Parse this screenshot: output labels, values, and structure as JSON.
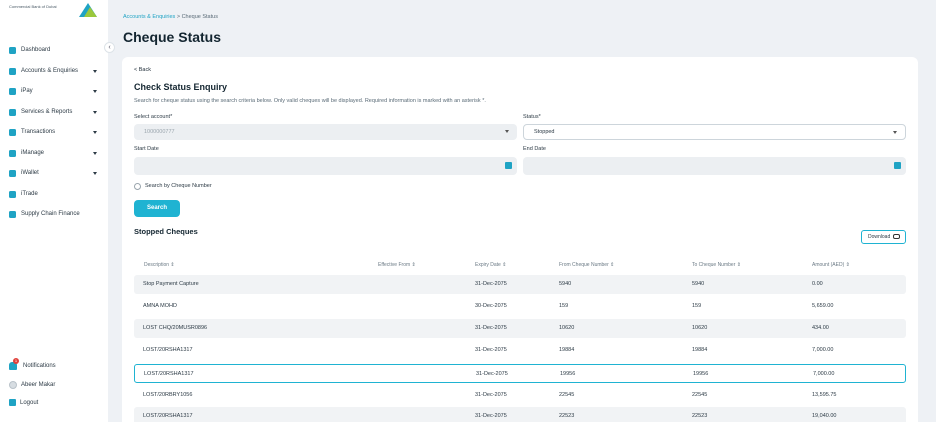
{
  "sidebar": {
    "logo_text": "Commercial Bank of Dubai",
    "items": [
      {
        "label": "Dashboard",
        "icon": "dashboard-icon",
        "caret": false
      },
      {
        "label": "Accounts & Enquiries",
        "icon": "accounts-icon",
        "caret": true
      },
      {
        "label": "iPay",
        "icon": "ipay-icon",
        "caret": true
      },
      {
        "label": "Services & Reports",
        "icon": "services-icon",
        "caret": true
      },
      {
        "label": "Transactions",
        "icon": "transactions-icon",
        "caret": true
      },
      {
        "label": "iManage",
        "icon": "imanage-icon",
        "caret": true
      },
      {
        "label": "iWallet",
        "icon": "iwallet-icon",
        "caret": true
      },
      {
        "label": "iTrade",
        "icon": "itrade-icon",
        "caret": false
      },
      {
        "label": "Supply Chain Finance",
        "icon": "supply-chain-icon",
        "caret": false
      }
    ],
    "notifications_label": "Notifications",
    "notifications_count": "1",
    "user_name": "Abeer Makar",
    "logout_label": "Logout"
  },
  "breadcrumb": {
    "parent": "Accounts & Enquiries",
    "separator": ">",
    "current": "Cheque Status"
  },
  "page_title": "Cheque Status",
  "form": {
    "back_label": "< Back",
    "title": "Check Status Enquiry",
    "description": "Search for cheque status using the search criteria below. Only valid cheques will be displayed. Required information is marked with an asterisk *.",
    "account_label": "Select account*",
    "account_value": "1000000777",
    "status_label": "Status*",
    "status_value": "Stopped",
    "start_date_label": "Start Date",
    "end_date_label": "End Date",
    "cheque_number_checkbox_label": "Search by Cheque Number",
    "search_button": "Search"
  },
  "results": {
    "title": "Stopped Cheques",
    "download_label": "Download",
    "columns": [
      "Description",
      "Effective From",
      "Expiry Date",
      "From Cheque Number",
      "To Cheque Number",
      "Amount (AED)"
    ],
    "rows": [
      {
        "description": "Stop Payment Capture",
        "effective_from": "",
        "expiry": "31-Dec-2075",
        "from": "5940",
        "to": "5940",
        "amount": "0.00"
      },
      {
        "description": "AMNA MOHD",
        "effective_from": "",
        "expiry": "30-Dec-2075",
        "from": "159",
        "to": "159",
        "amount": "5,659.00"
      },
      {
        "description": "LOST CHQ/20MUSR0896",
        "effective_from": "",
        "expiry": "31-Dec-2075",
        "from": "10620",
        "to": "10620",
        "amount": "434.00"
      },
      {
        "description": "LOST/20RSHA1317",
        "effective_from": "",
        "expiry": "31-Dec-2075",
        "from": "19884",
        "to": "19884",
        "amount": "7,000.00"
      },
      {
        "description": "LOST/20RSHA1317",
        "effective_from": "",
        "expiry": "31-Dec-2075",
        "from": "19956",
        "to": "19956",
        "amount": "7,000.00"
      },
      {
        "description": "LOST/20RBRY1056",
        "effective_from": "",
        "expiry": "31-Dec-2075",
        "from": "22545",
        "to": "22545",
        "amount": "13,595.75"
      },
      {
        "description": "LOST/20RSHA1317",
        "effective_from": "",
        "expiry": "31-Dec-2075",
        "from": "22523",
        "to": "22523",
        "amount": "19,040.00"
      }
    ]
  },
  "colors": {
    "accent": "#1fb3d2",
    "icon": "#1fa3c4",
    "background": "#eef1f5"
  }
}
